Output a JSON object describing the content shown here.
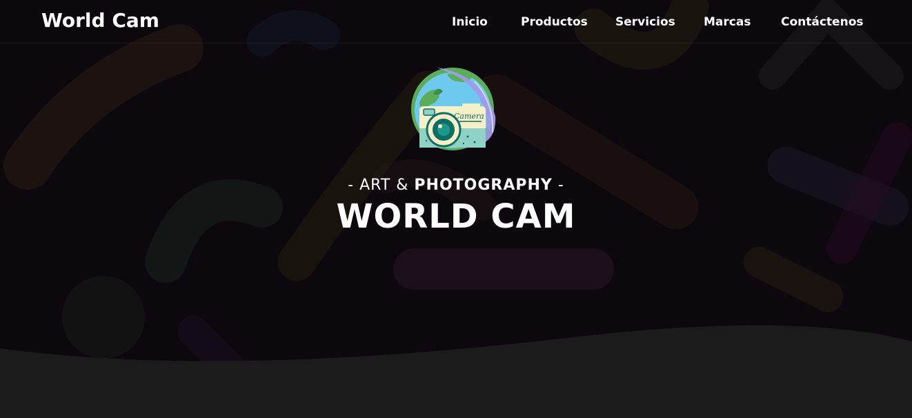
{
  "header": {
    "brand": "World Cam",
    "nav": [
      {
        "label": "Inicio"
      },
      {
        "label": "Productos"
      },
      {
        "label": "Servicios"
      },
      {
        "label": "Marcas"
      },
      {
        "label": "Contáctenos"
      }
    ]
  },
  "hero": {
    "tagline_prefix": "- ART & ",
    "tagline_bold": "PHOTOGRAPHY",
    "tagline_suffix": " -",
    "title": "WORLD CAM",
    "logo_icon": "camera-globe-logo",
    "logo_text": "Camera"
  },
  "colors": {
    "hero_bg": "#0e080f",
    "footer_bg": "#1b1b1b",
    "text": "#ffffff",
    "globe": "#6ec9ee",
    "land": "#5cad5a",
    "camera_body": "#f5f0c8",
    "lens": "#0e6e66",
    "brush": "#9f9ce8"
  }
}
